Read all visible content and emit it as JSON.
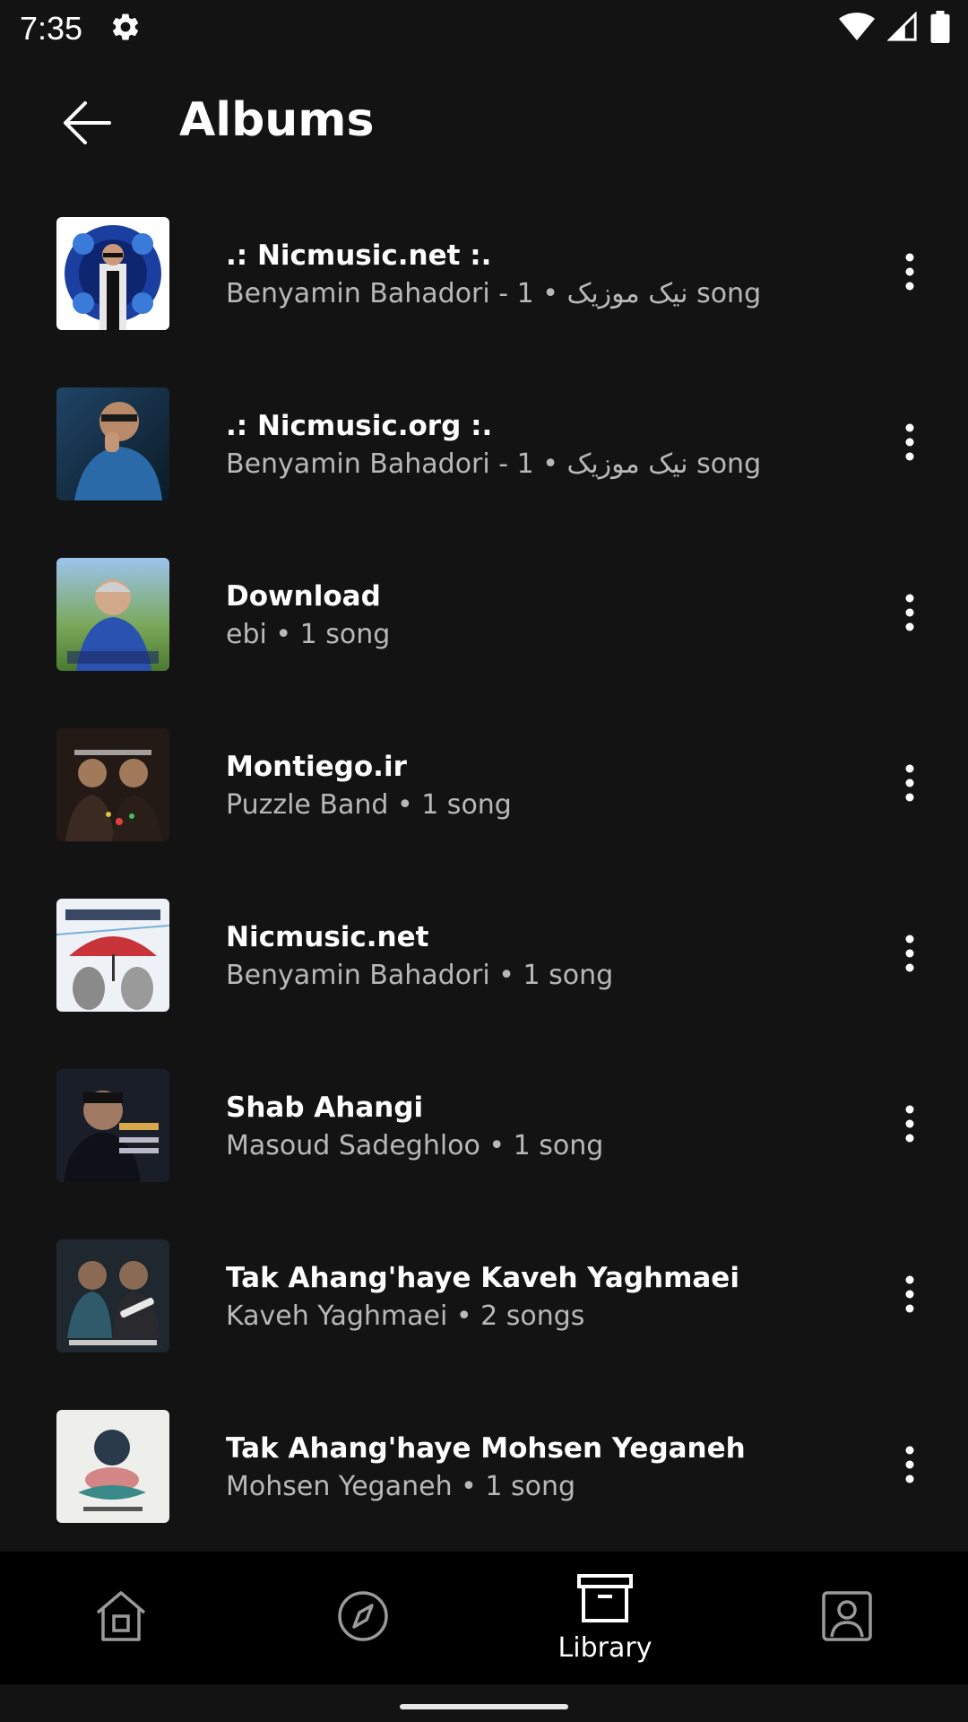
{
  "status_bar": {
    "time": "7:35",
    "icons": [
      "settings-icon",
      "wifi-icon",
      "signal-icon",
      "battery-icon"
    ]
  },
  "app_bar": {
    "title": "Albums",
    "back_icon": "arrow-back-icon"
  },
  "albums": [
    {
      "title": ".: Nicmusic.net :.",
      "subtitle": "Benyamin Bahadori - 1 • نیک موزیک song",
      "art_colors": [
        "#1a3fa0",
        "#ffffff"
      ]
    },
    {
      "title": ".: Nicmusic.org :.",
      "subtitle": "Benyamin Bahadori - 1 • نیک موزیک song",
      "art_colors": [
        "#1f4466",
        "#0c1a26"
      ]
    },
    {
      "title": "Download",
      "subtitle": "ebi • 1 song",
      "art_colors": [
        "#6aa0d8",
        "#2a52b0"
      ]
    },
    {
      "title": "Montiego.ir",
      "subtitle": "Puzzle Band • 1 song",
      "art_colors": [
        "#3a2a22",
        "#1a1410"
      ]
    },
    {
      "title": "Nicmusic.net",
      "subtitle": "Benyamin Bahadori • 1 song",
      "art_colors": [
        "#e8eef5",
        "#c8343a"
      ]
    },
    {
      "title": "Shab Ahangi",
      "subtitle": "Masoud Sadeghloo • 1 song",
      "art_colors": [
        "#2a2f3a",
        "#0e1118"
      ]
    },
    {
      "title": "Tak Ahang'haye Kaveh Yaghmaei",
      "subtitle": "Kaveh Yaghmaei • 2 songs",
      "art_colors": [
        "#2e3d44",
        "#141a1e"
      ]
    },
    {
      "title": "Tak Ahang'haye Mohsen Yeganeh",
      "subtitle": "Mohsen Yeganeh • 1 song",
      "art_colors": [
        "#eeeeea",
        "#3a8a8a"
      ]
    }
  ],
  "bottom_nav": {
    "items": [
      {
        "name": "home",
        "icon": "home-icon",
        "label": ""
      },
      {
        "name": "explore",
        "icon": "compass-icon",
        "label": ""
      },
      {
        "name": "library",
        "icon": "library-icon",
        "label": "Library",
        "selected": true
      },
      {
        "name": "account",
        "icon": "account-icon",
        "label": ""
      }
    ]
  },
  "colors": {
    "background": "#131313",
    "nav_background": "#000000",
    "subtitle": "#b8b8b8",
    "nav_icon_inactive": "#9a9a9a"
  }
}
